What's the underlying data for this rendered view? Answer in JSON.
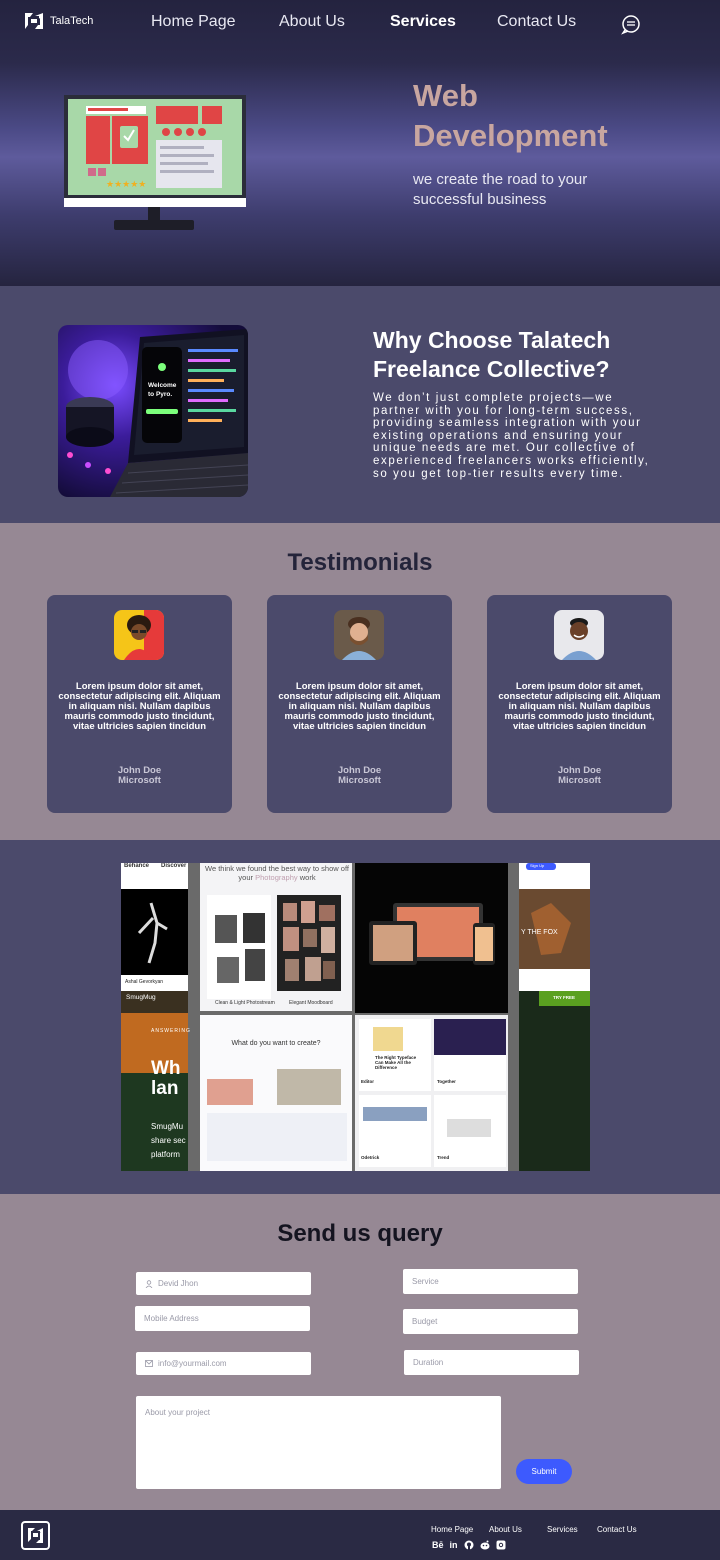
{
  "brand": {
    "name": "TalaTech"
  },
  "nav": {
    "items": [
      {
        "label": "Home Page"
      },
      {
        "label": "About Us"
      },
      {
        "label": "Services"
      },
      {
        "label": "Contact Us"
      }
    ],
    "active": "Services",
    "chat_icon": "chat-bubble-icon"
  },
  "hero": {
    "title_line1": "Web",
    "title_line2": "Development",
    "subtitle": "we create the road to your successful business",
    "title_color": "#c8a6a0"
  },
  "why": {
    "title": "Why Choose Talatech Freelance Collective?",
    "text": "We don’t just complete projects—we partner with you for long-term success, providing seamless integration with your existing operations and ensuring your unique needs are met. Our collective of experienced freelancers works efficiently, so you get top-tier results every time.",
    "photo_screen_text": "Welcome to Pyro."
  },
  "testimonials": {
    "title": "Testimonials",
    "cards": [
      {
        "quote": "Lorem ipsum dolor sit amet, consectetur adipiscing elit. Aliquam in aliquam nisi. Nullam dapibus mauris commodo justo tincidunt, vitae ultricies sapien tincidun",
        "name": "John Doe",
        "company": "Microsoft"
      },
      {
        "quote": "Lorem ipsum dolor sit amet, consectetur adipiscing elit. Aliquam in aliquam nisi. Nullam dapibus mauris commodo justo tincidunt, vitae ultricies sapien tincidun",
        "name": "John Doe",
        "company": "Microsoft"
      },
      {
        "quote": "Lorem ipsum dolor sit amet, consectetur adipiscing elit. Aliquam in aliquam nisi. Nullam dapibus mauris commodo justo tincidunt, vitae ultricies sapien tincidun",
        "name": "John Doe",
        "company": "Microsoft"
      }
    ]
  },
  "gallery": {
    "tile_behance": "Behance",
    "tile_discover": "Discover",
    "tile_heading_a": "We think we found the best way to show off your",
    "tile_heading_b": "Photography",
    "tile_heading_c": "work",
    "tile_clean": "Clean & Light Photostream",
    "tile_moodboard": "Elegant Moodboard",
    "tile_create": "What do you want to create?",
    "tile_fox": "Y THE FOX",
    "tile_try": "TRY FREE",
    "tile_smugmug": "SmugMug",
    "tile_answering": "ANSWERING",
    "tile_big": "Wh lan",
    "tile_smug_share": "SmugMu share sec platform",
    "tile_typeface": "The Right Typeface Can Make All the Difference",
    "tile_editor": "Editor",
    "tile_together": "Together",
    "tile_odetrick": "Odetrick",
    "tile_trend": "Trend",
    "tile_signup": "Sign Up",
    "tile_artist": "Ashal Gevorkyan"
  },
  "query": {
    "title": "Send us query",
    "name_placeholder": "Devid Jhon",
    "mobile_placeholder": "Mobile Address",
    "email_placeholder": "info@yourmail.com",
    "service_placeholder": "Service",
    "budget_placeholder": "Budget",
    "duration_placeholder": "Duration",
    "about_placeholder": "About your project",
    "submit_label": "Submit",
    "accent": "#3d5afe"
  },
  "footer": {
    "links": [
      {
        "label": "Home Page"
      },
      {
        "label": "About Us"
      },
      {
        "label": "Services"
      },
      {
        "label": "Contact Us"
      }
    ],
    "socials": [
      "behance-icon",
      "linkedin-icon",
      "github-icon",
      "reddit-icon",
      "instagram-icon"
    ],
    "behance_text": "Bē",
    "linkedin_text": "in"
  }
}
